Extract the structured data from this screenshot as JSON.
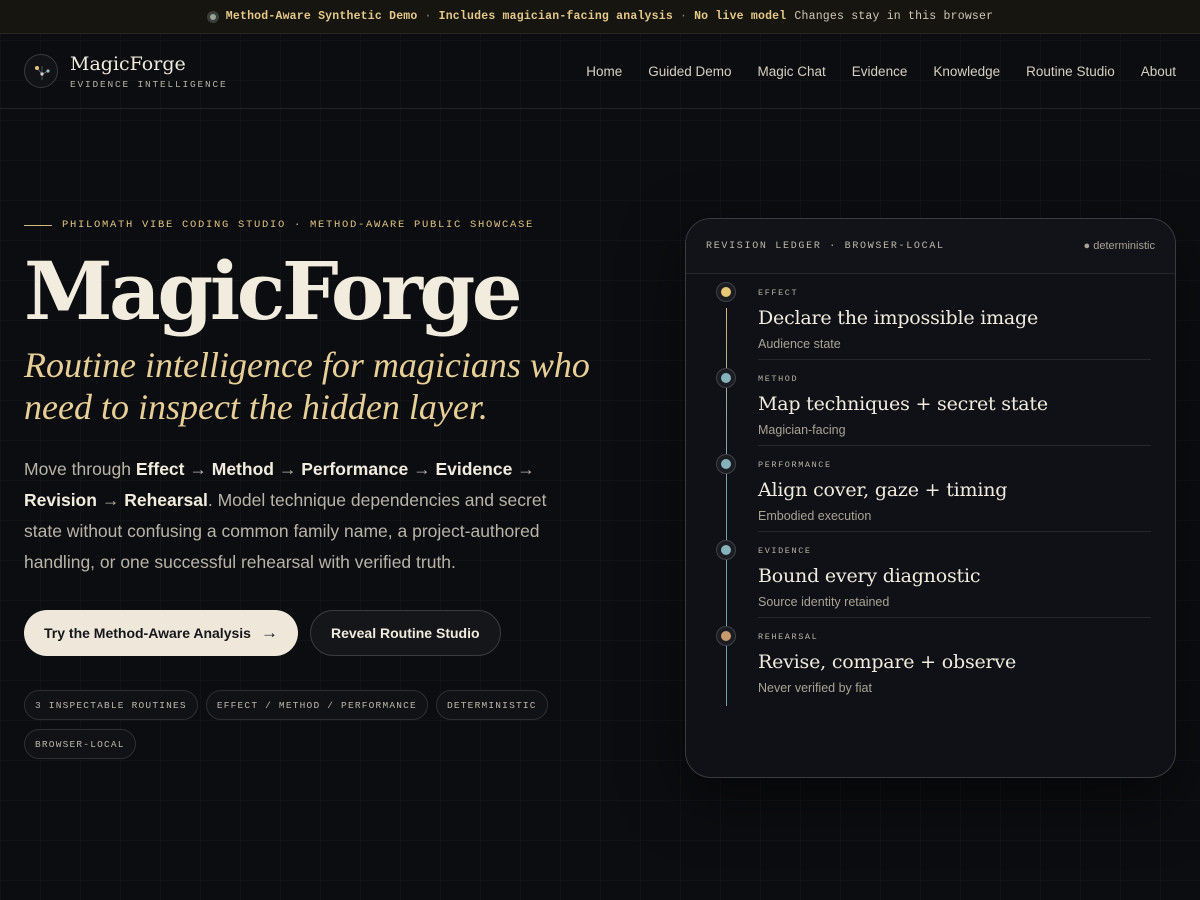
{
  "banner": {
    "items": [
      "Method-Aware Synthetic Demo",
      "Includes magician-facing analysis",
      "No live model"
    ],
    "separator": "·",
    "note": "Changes stay in this browser"
  },
  "header": {
    "brand_name": "MagicForge",
    "brand_tagline": "EVIDENCE INTELLIGENCE",
    "nav": [
      "Home",
      "Guided Demo",
      "Magic Chat",
      "Evidence",
      "Knowledge",
      "Routine Studio",
      "About"
    ]
  },
  "hero": {
    "eyebrow": "PHILOMATH VIBE CODING STUDIO · METHOD-AWARE PUBLIC SHOWCASE",
    "title": "MagicForge",
    "subtitle": "Routine intelligence for magicians who need to inspect the hidden layer.",
    "desc_intro": "Move through ",
    "flow": [
      "Effect",
      "Method",
      "Performance",
      "Evidence",
      "Revision",
      "Rehearsal"
    ],
    "flow_arrow": "→",
    "desc_rest": ". Model technique dependencies and secret state without confusing a common family name, a project-authored handling, or one successful rehearsal with verified truth.",
    "primary_button": "Try the Method-Aware Analysis",
    "primary_arrow": "→",
    "secondary_button": "Reveal Routine Studio",
    "chips": [
      "3 INSPECTABLE ROUTINES",
      "EFFECT / METHOD / PERFORMANCE",
      "DETERMINISTIC",
      "BROWSER-LOCAL"
    ]
  },
  "ledger": {
    "title": "REVISION LEDGER · BROWSER-LOCAL",
    "status": "● deterministic",
    "steps": [
      {
        "label": "EFFECT",
        "title": "Declare the impossible image",
        "sub": "Audience state",
        "color": "#e8c877"
      },
      {
        "label": "METHOD",
        "title": "Map techniques + secret state",
        "sub": "Magician-facing",
        "color": "#86b3bb"
      },
      {
        "label": "PERFORMANCE",
        "title": "Align cover, gaze + timing",
        "sub": "Embodied execution",
        "color": "#86b3bb"
      },
      {
        "label": "EVIDENCE",
        "title": "Bound every diagnostic",
        "sub": "Source identity retained",
        "color": "#86b3bb"
      },
      {
        "label": "REHEARSAL",
        "title": "Revise, compare + observe",
        "sub": "Never verified by fiat",
        "color": "#c79a6e"
      }
    ]
  },
  "icons": {
    "logo": "constellation-logo-icon",
    "arrow": "arrow-right-icon",
    "status_dot": "status-dot-icon"
  }
}
